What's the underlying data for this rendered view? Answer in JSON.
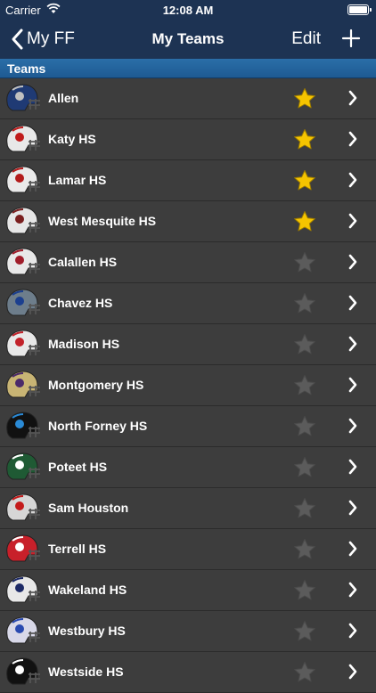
{
  "status": {
    "carrier": "Carrier",
    "time": "12:08 AM"
  },
  "nav": {
    "back_label": "My FF",
    "title": "My Teams",
    "edit_label": "Edit"
  },
  "section": {
    "title": "Teams"
  },
  "colors": {
    "favorite": "#f5c400",
    "unfavorite": "#5b5b5b",
    "header": "#1d3353",
    "section": "#2466a0"
  },
  "teams": [
    {
      "name": "Allen",
      "favorite": true,
      "helmet": "#1f3a74",
      "accent": "#c0c0c0"
    },
    {
      "name": "Katy HS",
      "favorite": true,
      "helmet": "#e8e8e8",
      "accent": "#c01c1c"
    },
    {
      "name": "Lamar HS",
      "favorite": true,
      "helmet": "#eaeaea",
      "accent": "#b31b1b"
    },
    {
      "name": "West Mesquite HS",
      "favorite": true,
      "helmet": "#e6e6e6",
      "accent": "#7a1f1f"
    },
    {
      "name": "Calallen HS",
      "favorite": false,
      "helmet": "#e8e8e8",
      "accent": "#a01d2a"
    },
    {
      "name": "Chavez HS",
      "favorite": false,
      "helmet": "#6d7d8b",
      "accent": "#1b3f8f"
    },
    {
      "name": "Madison HS",
      "favorite": false,
      "helmet": "#e8e8e8",
      "accent": "#c2222a"
    },
    {
      "name": "Montgomery HS",
      "favorite": false,
      "helmet": "#c8b474",
      "accent": "#4a2a6a"
    },
    {
      "name": "North Forney HS",
      "favorite": false,
      "helmet": "#111111",
      "accent": "#2a8ad6"
    },
    {
      "name": "Poteet HS",
      "favorite": false,
      "helmet": "#1f5a34",
      "accent": "#ffffff"
    },
    {
      "name": "Sam Houston",
      "favorite": false,
      "helmet": "#d6d6d6",
      "accent": "#c41a1a"
    },
    {
      "name": "Terrell HS",
      "favorite": false,
      "helmet": "#c8202a",
      "accent": "#ffffff"
    },
    {
      "name": "Wakeland HS",
      "favorite": false,
      "helmet": "#e8e8e8",
      "accent": "#1d2a66"
    },
    {
      "name": "Westbury HS",
      "favorite": false,
      "helmet": "#d8d8e8",
      "accent": "#2a4ab0"
    },
    {
      "name": "Westside HS",
      "favorite": false,
      "helmet": "#111111",
      "accent": "#ffffff"
    }
  ]
}
